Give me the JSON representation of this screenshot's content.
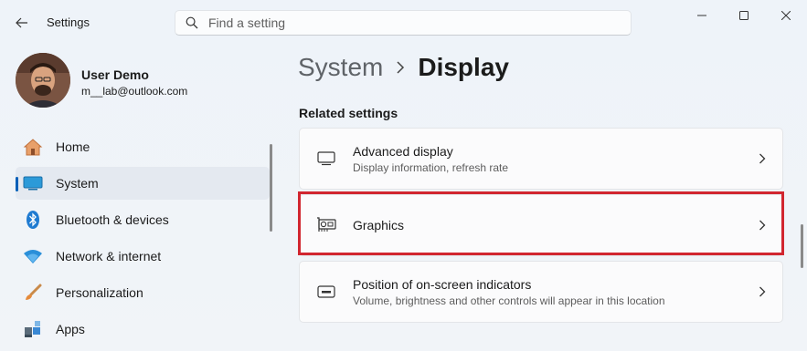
{
  "titlebar": {
    "app_title": "Settings",
    "search_placeholder": "Find a setting"
  },
  "profile": {
    "name": "User Demo",
    "email": "m__lab@outlook.com"
  },
  "sidebar": {
    "items": [
      {
        "label": "Home",
        "icon": "home-icon",
        "active": false
      },
      {
        "label": "System",
        "icon": "system-icon",
        "active": true
      },
      {
        "label": "Bluetooth & devices",
        "icon": "bluetooth-icon",
        "active": false
      },
      {
        "label": "Network & internet",
        "icon": "wifi-icon",
        "active": false
      },
      {
        "label": "Personalization",
        "icon": "brush-icon",
        "active": false
      },
      {
        "label": "Apps",
        "icon": "apps-icon",
        "active": false
      }
    ]
  },
  "breadcrumb": {
    "parent": "System",
    "current": "Display"
  },
  "main": {
    "section_title": "Related settings",
    "cards": [
      {
        "title": "Advanced display",
        "subtitle": "Display information, refresh rate",
        "icon": "monitor-icon"
      },
      {
        "title": "Graphics",
        "subtitle": "",
        "icon": "graphics-card-icon",
        "highlighted": true
      },
      {
        "title": "Position of on-screen indicators",
        "subtitle": "Volume, brightness and other controls will appear in this location",
        "icon": "indicator-icon"
      }
    ]
  },
  "colors": {
    "accent": "#005fb8",
    "highlight": "#d1262f"
  }
}
